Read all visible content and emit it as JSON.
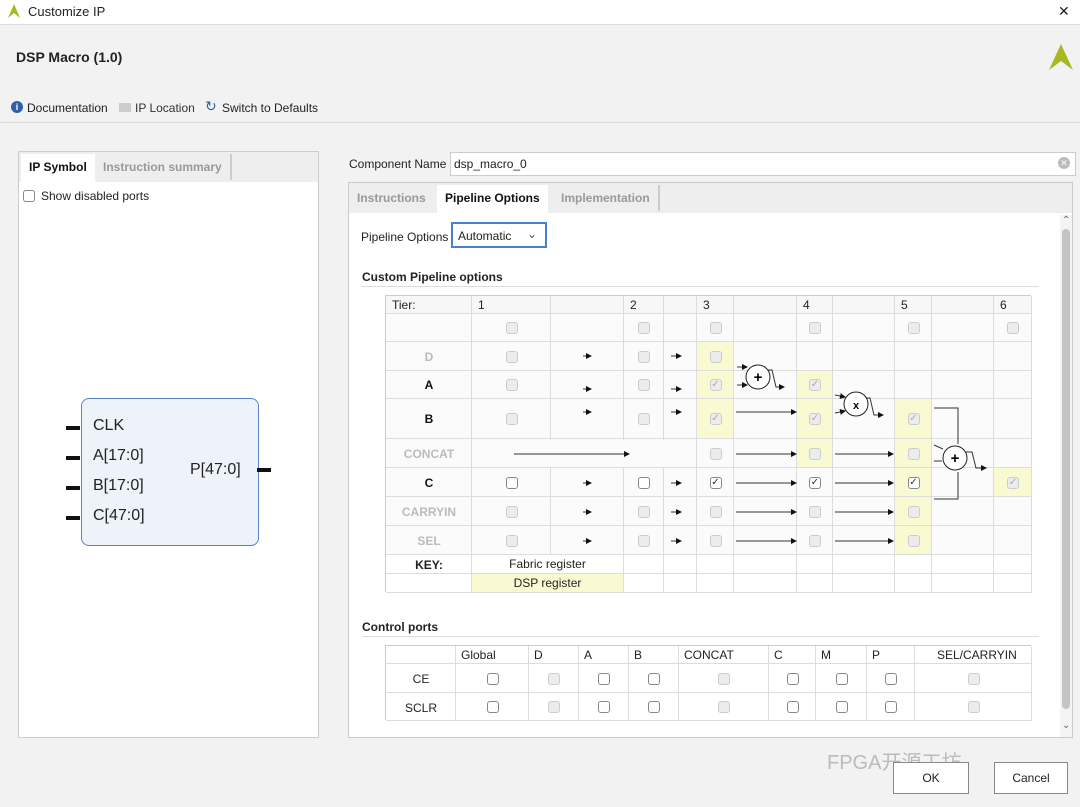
{
  "window": {
    "title": "Customize IP",
    "close": "✕"
  },
  "header": {
    "title": "DSP Macro (1.0)"
  },
  "toolbar": {
    "documentation": "Documentation",
    "ip_location": "IP Location",
    "switch_defaults": "Switch to Defaults"
  },
  "left": {
    "tabs": [
      "IP Symbol",
      "Instruction summary"
    ],
    "show_disabled": "Show disabled ports",
    "ports_in": [
      "CLK",
      "A[17:0]",
      "B[17:0]",
      "C[47:0]"
    ],
    "port_out": "P[47:0]"
  },
  "component": {
    "label": "Component Name",
    "value": "dsp_macro_0"
  },
  "tabs": [
    "Instructions",
    "Pipeline Options",
    "Implementation"
  ],
  "pipeline": {
    "label": "Pipeline Options",
    "value": "Automatic",
    "section": "Custom Pipeline options",
    "header": [
      "Tier:",
      "1",
      "",
      "2",
      "",
      "3",
      "",
      "4",
      "",
      "5",
      "",
      "6"
    ],
    "rows": [
      {
        "label": "",
        "enabled": true,
        "cells": [
          {
            "tier": 1,
            "checked": false,
            "disabled": true
          },
          {
            "tier": 2,
            "checked": false,
            "disabled": true
          },
          {
            "tier": 3,
            "checked": false,
            "disabled": true
          },
          {
            "tier": 4,
            "checked": false,
            "disabled": true
          },
          {
            "tier": 5,
            "checked": false,
            "disabled": true
          },
          {
            "tier": 6,
            "checked": false,
            "disabled": true
          }
        ]
      },
      {
        "label": "D",
        "enabled": false,
        "cells": [
          {
            "tier": 1,
            "checked": false,
            "disabled": true
          },
          {
            "tier": 2,
            "checked": false,
            "disabled": true
          },
          {
            "tier": 3,
            "checked": false,
            "disabled": true,
            "dsp": true
          }
        ]
      },
      {
        "label": "A",
        "enabled": true,
        "cells": [
          {
            "tier": 1,
            "checked": false,
            "disabled": true
          },
          {
            "tier": 2,
            "checked": false,
            "disabled": true
          },
          {
            "tier": 3,
            "checked": true,
            "disabled": true,
            "dsp": true
          },
          {
            "tier": 4,
            "checked": true,
            "disabled": true,
            "dsp": true
          }
        ]
      },
      {
        "label": "B",
        "enabled": true,
        "cells": [
          {
            "tier": 1,
            "checked": false,
            "disabled": true
          },
          {
            "tier": 2,
            "checked": false,
            "disabled": true
          },
          {
            "tier": 3,
            "checked": true,
            "disabled": true,
            "dsp": true
          },
          {
            "tier": 4,
            "checked": true,
            "disabled": true,
            "dsp": true
          },
          {
            "tier": 5,
            "checked": true,
            "disabled": true,
            "dsp": true
          }
        ]
      },
      {
        "label": "CONCAT",
        "enabled": false,
        "cells": [
          {
            "tier": 3,
            "checked": false,
            "disabled": true
          },
          {
            "tier": 4,
            "checked": false,
            "disabled": true,
            "dsp": true
          },
          {
            "tier": 5,
            "checked": false,
            "disabled": true,
            "dsp": true
          }
        ]
      },
      {
        "label": "C",
        "enabled": true,
        "cells": [
          {
            "tier": 1,
            "checked": false,
            "disabled": false
          },
          {
            "tier": 2,
            "checked": false,
            "disabled": false
          },
          {
            "tier": 3,
            "checked": true,
            "disabled": false
          },
          {
            "tier": 4,
            "checked": true,
            "disabled": false
          },
          {
            "tier": 5,
            "checked": true,
            "disabled": false,
            "dsp": true
          },
          {
            "tier": 6,
            "checked": true,
            "disabled": true,
            "dsp": true
          }
        ]
      },
      {
        "label": "CARRYIN",
        "enabled": false,
        "cells": [
          {
            "tier": 1,
            "checked": false,
            "disabled": true
          },
          {
            "tier": 2,
            "checked": false,
            "disabled": true
          },
          {
            "tier": 3,
            "checked": false,
            "disabled": true
          },
          {
            "tier": 4,
            "checked": false,
            "disabled": true
          },
          {
            "tier": 5,
            "checked": false,
            "disabled": true,
            "dsp": true
          }
        ]
      },
      {
        "label": "SEL",
        "enabled": false,
        "cells": [
          {
            "tier": 1,
            "checked": false,
            "disabled": true
          },
          {
            "tier": 2,
            "checked": false,
            "disabled": true
          },
          {
            "tier": 3,
            "checked": false,
            "disabled": true
          },
          {
            "tier": 4,
            "checked": false,
            "disabled": true
          },
          {
            "tier": 5,
            "checked": false,
            "disabled": true,
            "dsp": true
          }
        ]
      }
    ],
    "ops": [
      "+",
      "x",
      "+"
    ],
    "key": {
      "label": "KEY:",
      "fabric": "Fabric register",
      "dsp": "DSP register"
    }
  },
  "control": {
    "section": "Control ports",
    "columns": [
      "",
      "Global",
      "D",
      "A",
      "B",
      "CONCAT",
      "C",
      "M",
      "P",
      "SEL/CARRYIN"
    ],
    "rows": [
      {
        "label": "CE",
        "disabled": [
          false,
          true,
          false,
          false,
          true,
          false,
          false,
          false,
          true
        ]
      },
      {
        "label": "SCLR",
        "disabled": [
          false,
          true,
          false,
          false,
          true,
          false,
          false,
          false,
          true
        ]
      }
    ]
  },
  "buttons": {
    "ok": "OK",
    "cancel": "Cancel"
  },
  "watermark": "FPGA开源工坊",
  "colors": {
    "dsp": "#fafad2",
    "accent": "#4a7fd4",
    "logo": "#a8b820"
  }
}
